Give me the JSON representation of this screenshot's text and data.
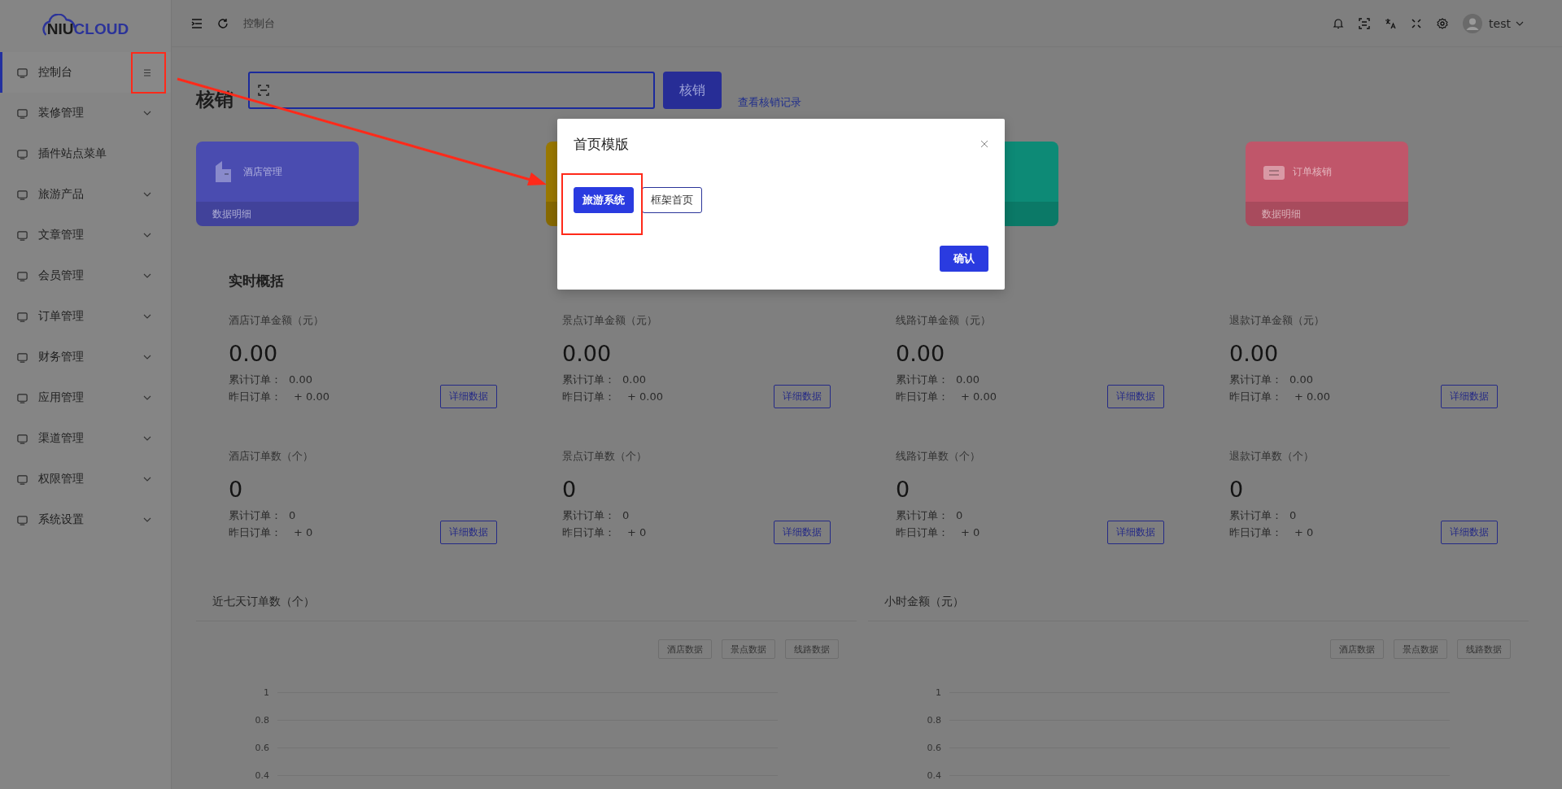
{
  "logo": [
    "NIU",
    "CLOUD"
  ],
  "sidebar": {
    "items": [
      {
        "label": "控制台",
        "selected": true,
        "expandable": false
      },
      {
        "label": "装修管理",
        "selected": false,
        "expandable": true
      },
      {
        "label": "插件站点菜单",
        "selected": false,
        "expandable": false
      },
      {
        "label": "旅游产品",
        "selected": false,
        "expandable": true
      },
      {
        "label": "文章管理",
        "selected": false,
        "expandable": true
      },
      {
        "label": "会员管理",
        "selected": false,
        "expandable": true
      },
      {
        "label": "订单管理",
        "selected": false,
        "expandable": true
      },
      {
        "label": "财务管理",
        "selected": false,
        "expandable": true
      },
      {
        "label": "应用管理",
        "selected": false,
        "expandable": true
      },
      {
        "label": "渠道管理",
        "selected": false,
        "expandable": true
      },
      {
        "label": "权限管理",
        "selected": false,
        "expandable": true
      },
      {
        "label": "系统设置",
        "selected": false,
        "expandable": true
      }
    ]
  },
  "topbar": {
    "breadcrumb": "控制台",
    "user": "test"
  },
  "verify": {
    "title": "核销",
    "button": "核销",
    "link": "查看核销记录"
  },
  "cards": [
    {
      "color": "#4a4cb0",
      "title": "酒店管理",
      "footer": "数据明细"
    },
    {
      "color": "#9a7800"
    },
    {
      "color": "#0d8a76"
    },
    {
      "color": "#c0566a",
      "title": "订单核销",
      "footer": "数据明细"
    }
  ],
  "overview": {
    "title": "实时概括",
    "stats": [
      {
        "label": "酒店订单金额（元）",
        "value": "0.00",
        "total_label": "累计订单：",
        "total": "0.00",
        "yesterday_label": "昨日订单：",
        "yesterday": "+ 0.00",
        "button": "详细数据"
      },
      {
        "label": "景点订单金额（元）",
        "value": "0.00",
        "total_label": "累计订单：",
        "total": "0.00",
        "yesterday_label": "昨日订单：",
        "yesterday": "+ 0.00",
        "button": "详细数据"
      },
      {
        "label": "线路订单金额（元）",
        "value": "0.00",
        "total_label": "累计订单：",
        "total": "0.00",
        "yesterday_label": "昨日订单：",
        "yesterday": "+ 0.00",
        "button": "详细数据"
      },
      {
        "label": "退款订单金额（元）",
        "value": "0.00",
        "total_label": "累计订单：",
        "total": "0.00",
        "yesterday_label": "昨日订单：",
        "yesterday": "+ 0.00",
        "button": "详细数据"
      },
      {
        "label": "酒店订单数（个）",
        "value": "0",
        "total_label": "累计订单：",
        "total": "0",
        "yesterday_label": "昨日订单：",
        "yesterday": "+ 0",
        "button": "详细数据"
      },
      {
        "label": "景点订单数（个）",
        "value": "0",
        "total_label": "累计订单：",
        "total": "0",
        "yesterday_label": "昨日订单：",
        "yesterday": "+ 0",
        "button": "详细数据"
      },
      {
        "label": "线路订单数（个）",
        "value": "0",
        "total_label": "累计订单：",
        "total": "0",
        "yesterday_label": "昨日订单：",
        "yesterday": "+ 0",
        "button": "详细数据"
      },
      {
        "label": "退款订单数（个）",
        "value": "0",
        "total_label": "累计订单：",
        "total": "0",
        "yesterday_label": "昨日订单：",
        "yesterday": "+ 0",
        "button": "详细数据"
      }
    ]
  },
  "charts": [
    {
      "title": "近七天订单数（个）",
      "buttons": [
        "酒店数据",
        "景点数据",
        "线路数据"
      ],
      "y_ticks": [
        "1",
        "0.8",
        "0.6",
        "0.4"
      ]
    },
    {
      "title": "小时金额（元）",
      "buttons": [
        "酒店数据",
        "景点数据",
        "线路数据"
      ],
      "y_ticks": [
        "1",
        "0.8",
        "0.6",
        "0.4"
      ]
    }
  ],
  "dialog": {
    "title": "首页模版",
    "options": [
      {
        "label": "旅游系统",
        "selected": true
      },
      {
        "label": "框架首页",
        "selected": false
      }
    ],
    "confirm": "确认"
  }
}
